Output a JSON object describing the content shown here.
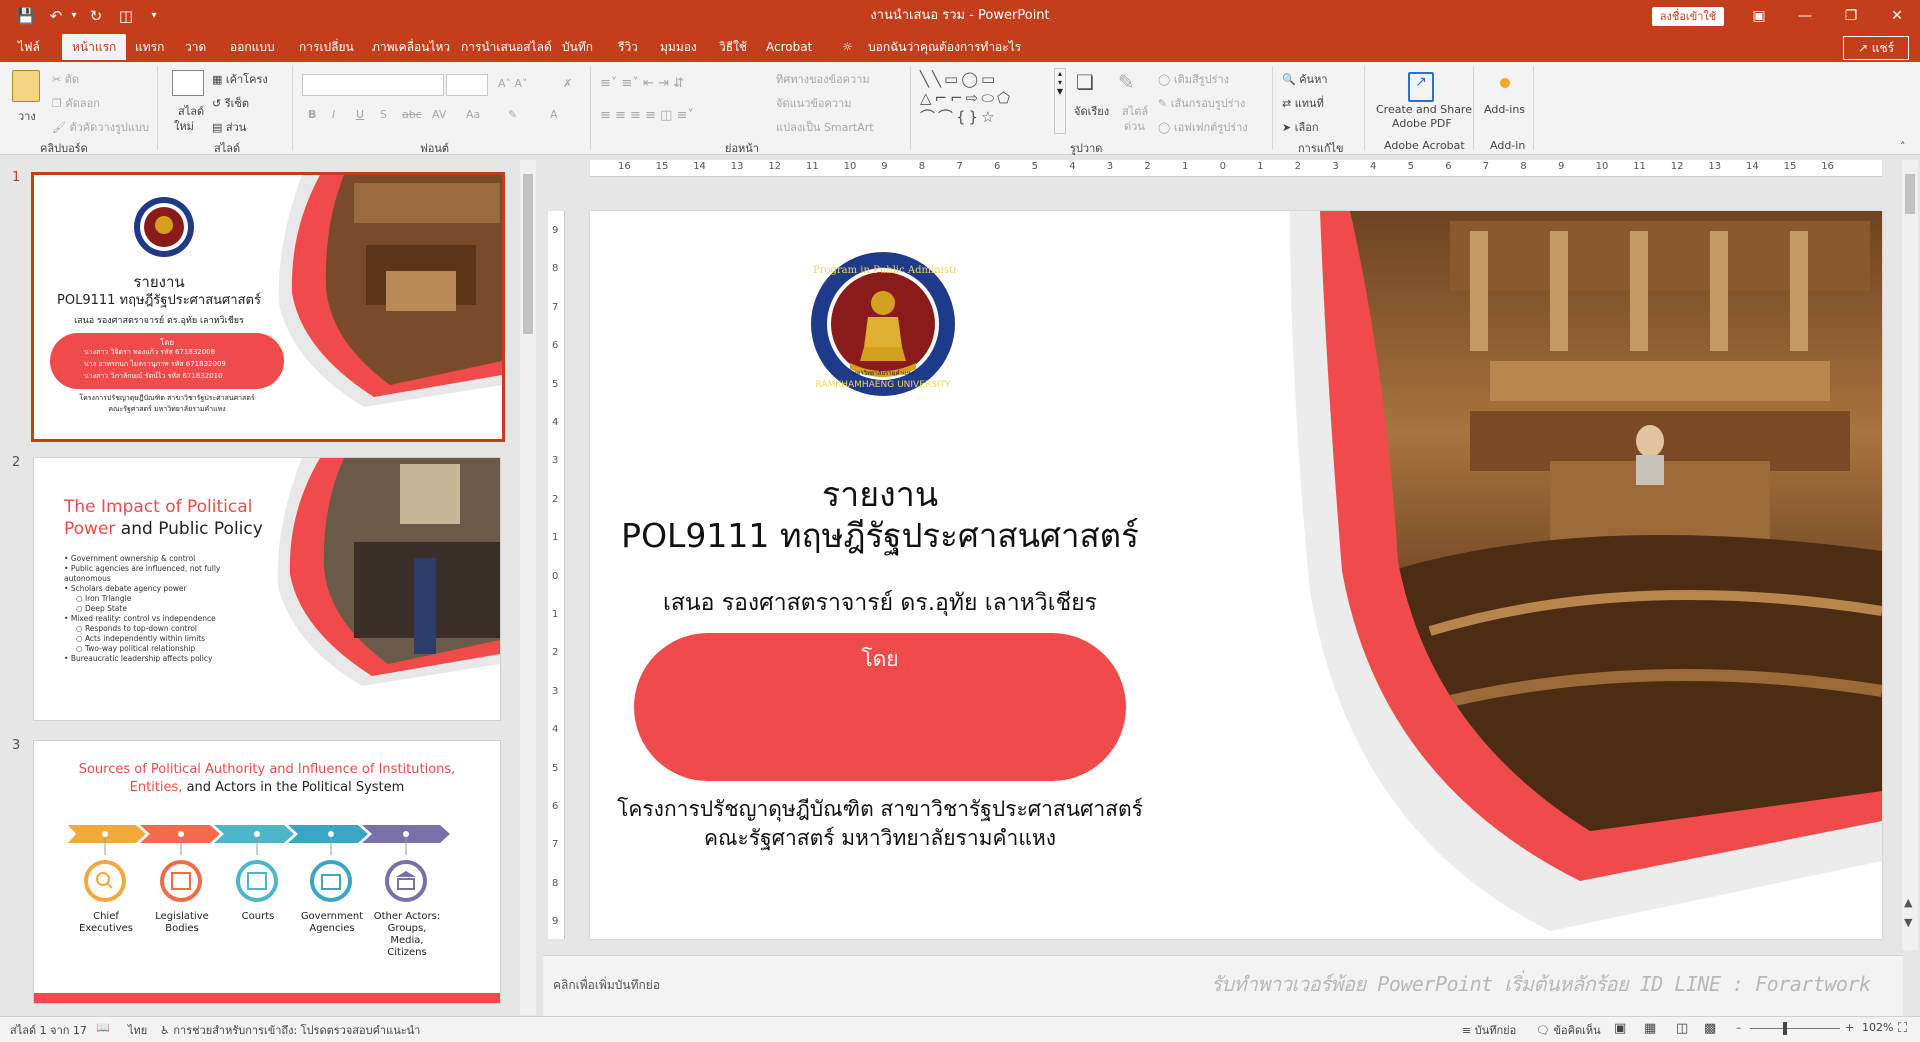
{
  "window": {
    "title": "งานนำเสนอ รวม  -  PowerPoint",
    "signin_label": "ลงชื่อเข้าใช้",
    "share_label": "แชร์"
  },
  "tabs": [
    "ไฟล์",
    "หน้าแรก",
    "แทรก",
    "วาด",
    "ออกแบบ",
    "การเปลี่ยน",
    "ภาพเคลื่อนไหว",
    "การนำเสนอสไลด์",
    "บันทึก",
    "รีวิว",
    "มุมมอง",
    "วิธีใช้",
    "Acrobat"
  ],
  "tell_me": "บอกฉันว่าคุณต้องการทำอะไร",
  "ribbon": {
    "clipboard": {
      "paste": "วาง",
      "cut": "ตัด",
      "copy": "คัดลอก",
      "format_painter": "ตัวคัดวางรูปแบบ",
      "label": "คลิปบอร์ด"
    },
    "slides": {
      "new_slide": "สไลด์",
      "new_slide2": "ใหม่",
      "layout": "เค้าโครง",
      "reset": "รีเซ็ต",
      "section": "ส่วน",
      "label": "สไลด์"
    },
    "font": {
      "label": "ฟอนต์",
      "bold": "B",
      "italic": "I",
      "underline": "U",
      "shadow": "S",
      "strike": "abc",
      "spacing": "AV",
      "case": "Aa",
      "color": "A"
    },
    "paragraph": {
      "text_direction": "ทิศทางของข้อความ",
      "align_text": "จัดแนวข้อความ",
      "smartart": "แปลงเป็น SmartArt",
      "label": "ย่อหน้า"
    },
    "drawing": {
      "arrange": "จัดเรียง",
      "quick_styles": "ด่วน",
      "quick_styles1": "สไตล์",
      "shape_fill": "เติมสีรูปร่าง",
      "shape_outline": "เส้นกรอบรูปร่าง",
      "shape_effects": "เอฟเฟกต์รูปร่าง",
      "label": "รูปวาด"
    },
    "editing": {
      "find": "ค้นหา",
      "replace": "แทนที่",
      "select": "เลือก",
      "label": "การแก้ไข"
    },
    "acrobat": {
      "create_share": "Create and Share",
      "adobe_pdf": "Adobe PDF",
      "label": "Adobe Acrobat"
    },
    "addins": {
      "addins": "Add-ins",
      "label": "Add-in"
    }
  },
  "thumbnails": [
    {
      "num": "1",
      "title1": "รายงาน",
      "title2": "POL9111 ทฤษฎีรัฐประศาสนศาสตร์",
      "presenter": "เสนอ รองศาสตราจารย์ ดร.อุทัย เลาหวิเชียร",
      "by": "โดย",
      "members": [
        "นางสาว วิจิตรา ทองแก้ว     รหัส 671832008",
        "นาง อาทรกนก ไมตรานุภาพ  รหัส 671832009",
        "นางสาว วิภาลักษณ์ รัตน์ไว    รหัส 671832010"
      ],
      "footer1": "โครงการปรัชญาดุษฎีบัณฑิต สาขาวิชารัฐประศาสนศาสตร์",
      "footer2": "คณะรัฐศาสตร์ มหาวิทยาลัยรามคำแหง"
    },
    {
      "num": "2",
      "title_red": "The Impact of Political",
      "title_red2": "Power",
      "title_dark": " and Public Policy",
      "bullets": [
        "Government ownership & control",
        "Public agencies are influenced, not fully autonomous",
        "Scholars debate agency power",
        "Mixed reality: control vs independence",
        "Bureaucratic leadership affects policy"
      ],
      "sub_a": [
        "Iron Triangle",
        "Deep State"
      ],
      "sub_b": [
        "Responds to top-down control",
        "Acts independently within limits",
        "Two-way political relationship"
      ]
    },
    {
      "num": "3",
      "title_red": "Sources of Political Authority and Influence of Institutions,",
      "title_line2_red": "Entities,",
      "title_line2_dark": " and Actors in the Political System",
      "items": [
        {
          "label": "Chief\nExecutives",
          "color": "#f2a93b"
        },
        {
          "label": "Legislative\nBodies",
          "color": "#ef6b4a"
        },
        {
          "label": "Courts",
          "color": "#4fb6c9"
        },
        {
          "label": "Government\nAgencies",
          "color": "#3aa6c4"
        },
        {
          "label": "Other Actors:\nGroups,\nMedia,\nCitizens",
          "color": "#7b6fa8"
        }
      ]
    }
  ],
  "slide": {
    "seal_top": "Ph.D. Program in Public Administration",
    "seal_bottom": "RAMKHAMHAENG UNIVERSITY",
    "seal_inner": "มหาวิทยาลัยรามคำแหง",
    "title1": "รายงาน",
    "title2": "POL9111 ทฤษฎีรัฐประศาสนศาสตร์",
    "presenter": "เสนอ รองศาสตราจารย์ ดร.อุทัย  เลาหวิเชียร",
    "by": "โดย",
    "footer1": "โครงการปรัชญาดุษฎีบัณฑิต สาขาวิชารัฐประศาสนศาสตร์",
    "footer2": "คณะรัฐศาสตร์ มหาวิทยาลัยรามคำแหง",
    "accent": "#ef4b4b"
  },
  "notes_placeholder": "คลิกเพื่อเพิ่มบันทึกย่อ",
  "watermark": "รับทำพาวเวอร์พ้อย PowerPoint เริ่มต้นหลักร้อย ID LINE : Forartwork",
  "status": {
    "slide_of": "สไลด์ 1 จาก 17",
    "lang": "ไทย",
    "accessibility": "การช่วยสำหรับการเข้าถึง: โปรดตรวจสอบคำแนะนำ",
    "notes": "บันทึกย่อ",
    "comments": "ข้อคิดเห็น",
    "zoom": "102%"
  },
  "ruler_h": [
    "16",
    "15",
    "14",
    "13",
    "12",
    "11",
    "10",
    "9",
    "8",
    "7",
    "6",
    "5",
    "4",
    "3",
    "2",
    "1",
    "0",
    "1",
    "2",
    "3",
    "4",
    "5",
    "6",
    "7",
    "8",
    "9",
    "10",
    "11",
    "12",
    "13",
    "14",
    "15",
    "16"
  ],
  "ruler_v": [
    "9",
    "8",
    "7",
    "6",
    "5",
    "4",
    "3",
    "2",
    "1",
    "0",
    "1",
    "2",
    "3",
    "4",
    "5",
    "6",
    "7",
    "8",
    "9"
  ]
}
